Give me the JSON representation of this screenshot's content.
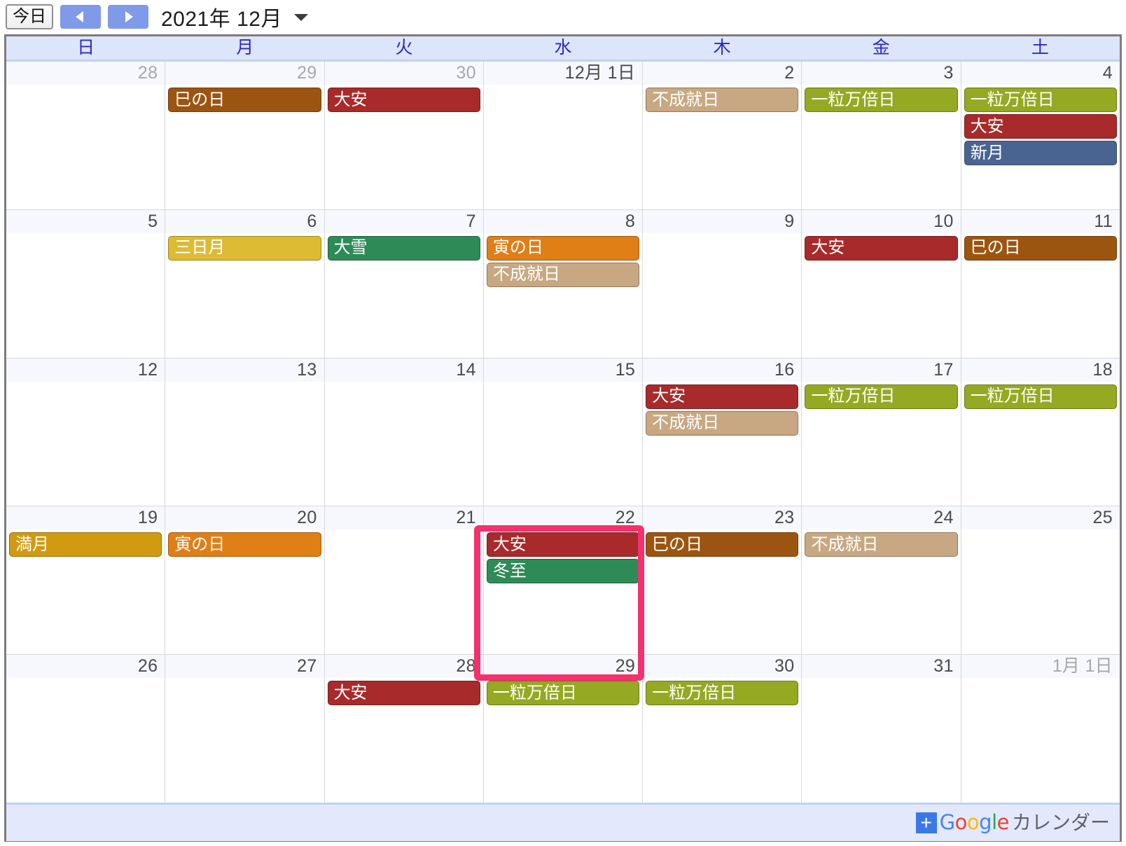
{
  "toolbar": {
    "today_label": "今日",
    "prev_label": "前の月",
    "next_label": "次の月",
    "title": "2021年 12月",
    "dropdown_label": "表示切替"
  },
  "weekdays": [
    "日",
    "月",
    "火",
    "水",
    "木",
    "金",
    "土"
  ],
  "colors": {
    "brown": "#9c5510",
    "red": "#a82a2a",
    "tan": "#c7a882",
    "olive": "#95a922",
    "blue": "#4a6491",
    "yellow": "#ddbb33",
    "green": "#2e8b57",
    "orange": "#df7f16",
    "gold": "#d29a10",
    "highlight_pink": "#f4306d",
    "nav_blue": "#7e9ae8",
    "header_bg": "#dde5fa",
    "footer_bg": "#e3e9fb"
  },
  "highlight": {
    "day": "22",
    "note": "強調枠"
  },
  "weeks": [
    {
      "days": [
        {
          "num": "28",
          "muted": true,
          "events": []
        },
        {
          "num": "29",
          "muted": true,
          "events": [
            {
              "title": "巳の日",
              "color": "#9c5510"
            }
          ]
        },
        {
          "num": "30",
          "muted": true,
          "events": [
            {
              "title": "大安",
              "color": "#a82a2a"
            }
          ]
        },
        {
          "num": "12月 1日",
          "muted": false,
          "events": []
        },
        {
          "num": "2",
          "muted": false,
          "events": [
            {
              "title": "不成就日",
              "color": "#c7a882"
            }
          ]
        },
        {
          "num": "3",
          "muted": false,
          "events": [
            {
              "title": "一粒万倍日",
              "color": "#95a922"
            }
          ]
        },
        {
          "num": "4",
          "muted": false,
          "events": [
            {
              "title": "一粒万倍日",
              "color": "#95a922"
            },
            {
              "title": "大安",
              "color": "#a82a2a"
            },
            {
              "title": "新月",
              "color": "#4a6491"
            }
          ]
        }
      ]
    },
    {
      "days": [
        {
          "num": "5",
          "muted": false,
          "events": []
        },
        {
          "num": "6",
          "muted": false,
          "events": [
            {
              "title": "三日月",
              "color": "#ddbb33"
            }
          ]
        },
        {
          "num": "7",
          "muted": false,
          "events": [
            {
              "title": "大雪",
              "color": "#2e8b57"
            }
          ]
        },
        {
          "num": "8",
          "muted": false,
          "events": [
            {
              "title": "寅の日",
              "color": "#df7f16"
            },
            {
              "title": "不成就日",
              "color": "#c7a882"
            }
          ]
        },
        {
          "num": "9",
          "muted": false,
          "events": []
        },
        {
          "num": "10",
          "muted": false,
          "events": [
            {
              "title": "大安",
              "color": "#a82a2a"
            }
          ]
        },
        {
          "num": "11",
          "muted": false,
          "events": [
            {
              "title": "巳の日",
              "color": "#9c5510"
            }
          ]
        }
      ]
    },
    {
      "days": [
        {
          "num": "12",
          "muted": false,
          "events": []
        },
        {
          "num": "13",
          "muted": false,
          "events": []
        },
        {
          "num": "14",
          "muted": false,
          "events": []
        },
        {
          "num": "15",
          "muted": false,
          "events": []
        },
        {
          "num": "16",
          "muted": false,
          "events": [
            {
              "title": "大安",
              "color": "#a82a2a"
            },
            {
              "title": "不成就日",
              "color": "#c7a882"
            }
          ]
        },
        {
          "num": "17",
          "muted": false,
          "events": [
            {
              "title": "一粒万倍日",
              "color": "#95a922"
            }
          ]
        },
        {
          "num": "18",
          "muted": false,
          "events": [
            {
              "title": "一粒万倍日",
              "color": "#95a922"
            }
          ]
        }
      ]
    },
    {
      "days": [
        {
          "num": "19",
          "muted": false,
          "events": [
            {
              "title": "満月",
              "color": "#d29a10"
            }
          ]
        },
        {
          "num": "20",
          "muted": false,
          "events": [
            {
              "title": "寅の日",
              "color": "#df7f16"
            }
          ]
        },
        {
          "num": "21",
          "muted": false,
          "events": []
        },
        {
          "num": "22",
          "muted": false,
          "events": [
            {
              "title": "大安",
              "color": "#a82a2a"
            },
            {
              "title": "冬至",
              "color": "#2e8b57"
            }
          ]
        },
        {
          "num": "23",
          "muted": false,
          "events": [
            {
              "title": "巳の日",
              "color": "#9c5510"
            }
          ]
        },
        {
          "num": "24",
          "muted": false,
          "events": [
            {
              "title": "不成就日",
              "color": "#c7a882"
            }
          ]
        },
        {
          "num": "25",
          "muted": false,
          "events": []
        }
      ]
    },
    {
      "days": [
        {
          "num": "26",
          "muted": false,
          "events": []
        },
        {
          "num": "27",
          "muted": false,
          "events": []
        },
        {
          "num": "28",
          "muted": false,
          "events": [
            {
              "title": "大安",
              "color": "#a82a2a"
            }
          ]
        },
        {
          "num": "29",
          "muted": false,
          "events": [
            {
              "title": "一粒万倍日",
              "color": "#95a922"
            }
          ]
        },
        {
          "num": "30",
          "muted": false,
          "events": [
            {
              "title": "一粒万倍日",
              "color": "#95a922"
            }
          ]
        },
        {
          "num": "31",
          "muted": false,
          "events": []
        },
        {
          "num": "1月 1日",
          "muted": true,
          "events": []
        }
      ]
    }
  ],
  "footer": {
    "plus": "+",
    "google": [
      "G",
      "o",
      "o",
      "g",
      "l",
      "e"
    ],
    "label": "カレンダー"
  }
}
